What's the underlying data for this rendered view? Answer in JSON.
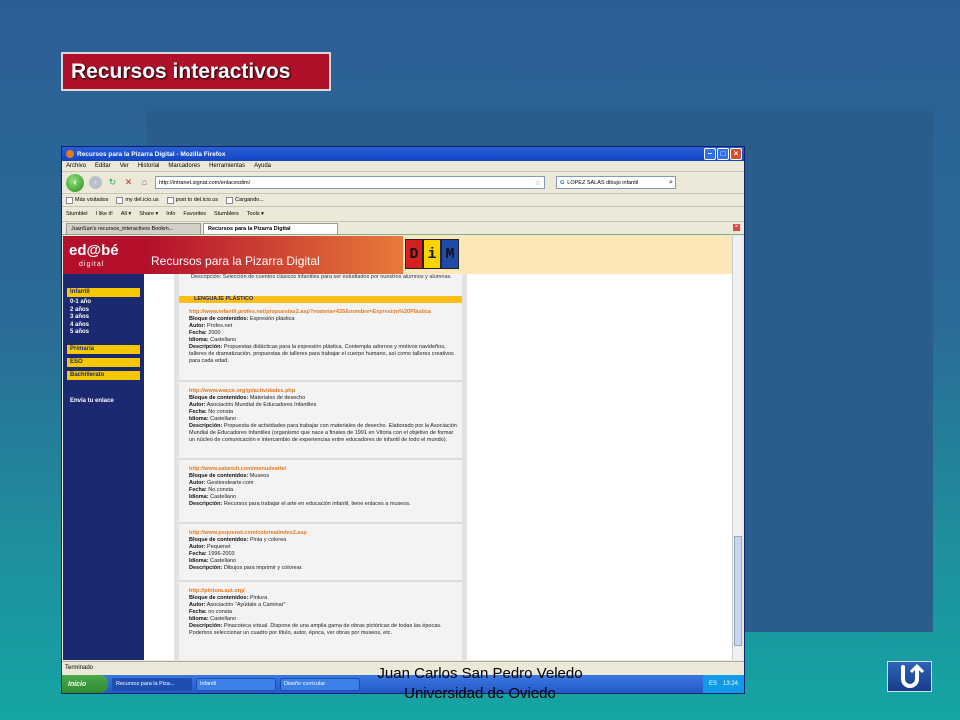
{
  "slide": {
    "title": "Recursos interactivos",
    "footer_line1": "Juan Carlos San Pedro Veledo",
    "footer_line2": "Universidad de Oviedo"
  },
  "browser": {
    "window_title": "Recursos para la Pizarra Digital - Mozilla Firefox",
    "menu": [
      "Archivo",
      "Editar",
      "Ver",
      "Historial",
      "Marcadores",
      "Herramientas",
      "Ayuda"
    ],
    "url": "http://intranet.signat.com/enlacesdim/",
    "search_value": "LOPEZ SALAS dibujo infantil",
    "bookmarks": [
      "Más visitados",
      "my del.icio.us",
      "post to del.icio.us",
      "Cargando..."
    ],
    "stumble_bar": [
      "StumbleI",
      "I like it!",
      "All ▾",
      "Share ▾",
      "Info",
      "Favorites",
      "Stumblers",
      "Tools ▾"
    ],
    "tabs": [
      "JuanSan's recursos_interactivos Bookm...",
      "Recursos para la Pizarra Digital"
    ],
    "status": "Terminado"
  },
  "site": {
    "logo": "ed@bé",
    "logo_sub": "digital",
    "header_title": "Recursos para la Pizarra Digital",
    "dim_letters": [
      "D",
      "i",
      "M"
    ],
    "sidebar": {
      "infantil": "Infantil",
      "ages": [
        "0-1 año",
        "2 años",
        "3 años",
        "4 años",
        "5 años"
      ],
      "primaria": "Primaria",
      "eso": "ESO",
      "bachillerato": "Bachillerato",
      "send_link": "Envía tu enlace"
    },
    "top_text": "Descripción: Selección de cuentos clásicos infantiles para ser estudiados por nuestros alumnos y alumnas.",
    "section_title": "LENGUAJE PLÁSTICO",
    "entries": [
      {
        "url": "http://www.infantil.profes.net/propuestas2.asp?materia=435&nombre=Expresión%20Plástica",
        "block_label": "Bloque de contenidos:",
        "block": "Expresión plástica",
        "author_label": "Autor:",
        "author": "Profes.net",
        "date_label": "Fecha:",
        "date": "2000",
        "lang_label": "Idioma:",
        "lang": "Castellano",
        "desc_label": "Descripción:",
        "desc": "Propuestas didácticas para la expresión plástica. Contempla adornos y motivos navideños, talleres de dramatización, propuestas de talleres para trabajar el cuerpo humano, así como talleres creativos para cada edad."
      },
      {
        "url": "http://www.waece.org/gt/actividades.php",
        "block_label": "Bloque de contenidos:",
        "block": "Materiales de desecho",
        "author_label": "Autor:",
        "author": "Asociación Mundial de Educadores Infantiles",
        "date_label": "Fecha:",
        "date": "No consta",
        "lang_label": "Idioma:",
        "lang": "Castellano",
        "desc_label": "Descripción:",
        "desc": "Propuesta de actividades para trabajar con materiales de desecho. Elaborado por la Asociación Mundial de Educadores Infantiles (organismo que nace a finales de 1991 en Vitoria con el objetivo de formar un núcleo de comunicación e intercambio de experiencias entre educadores de infantil de todo el mundo)."
      },
      {
        "url": "http://www.salarich.com/menudearte/",
        "block_label": "Bloque de contenidos:",
        "block": "Museos",
        "author_label": "Autor:",
        "author": "Gestiondearte.com",
        "date_label": "Fecha:",
        "date": "No consta",
        "lang_label": "Idioma:",
        "lang": "Castellano",
        "desc_label": "Descripción:",
        "desc": "Recursos para trabajar el arte en educación infantil, tiene enlaces a museos."
      },
      {
        "url": "http://www.pequenet.com/colorea/index2.asp",
        "block_label": "Bloque de contenidos:",
        "block": "Pinta y colorea",
        "author_label": "Autor:",
        "author": "Pequenet",
        "date_label": "Fecha:",
        "date": "1996-2003",
        "lang_label": "Idioma:",
        "lang": "Castellano",
        "desc_label": "Descripción:",
        "desc": "Dibujos para imprimir y colorear."
      },
      {
        "url": "http://pintura.aut.org/",
        "block_label": "Bloque de contenidos:",
        "block": "Pintura",
        "author_label": "Autor:",
        "author": "Asociación \"Ayúdale a Caminar\"",
        "date_label": "Fecha:",
        "date": "no consta",
        "lang_label": "Idioma:",
        "lang": "Castellano",
        "desc_label": "Descripción:",
        "desc": "Pinacoteca virtual. Dispone de una amplia gama de obras pictóricas de todas las épocas. Podemos seleccionar un cuadro por título, autor, época, ver obras por museos, etc."
      }
    ]
  },
  "taskbar": {
    "start": "Inicio",
    "items": [
      "Recursos para la Piza...",
      "Infantil",
      "Diseño curricular"
    ],
    "lang": "ES",
    "clock": "13:24"
  },
  "colors": {
    "title_bg": "#b0112a",
    "site_red": "#b4102c",
    "site_navy": "#1b2a70",
    "section_yellow": "#fcbf16",
    "link_orange": "#e8781d"
  }
}
